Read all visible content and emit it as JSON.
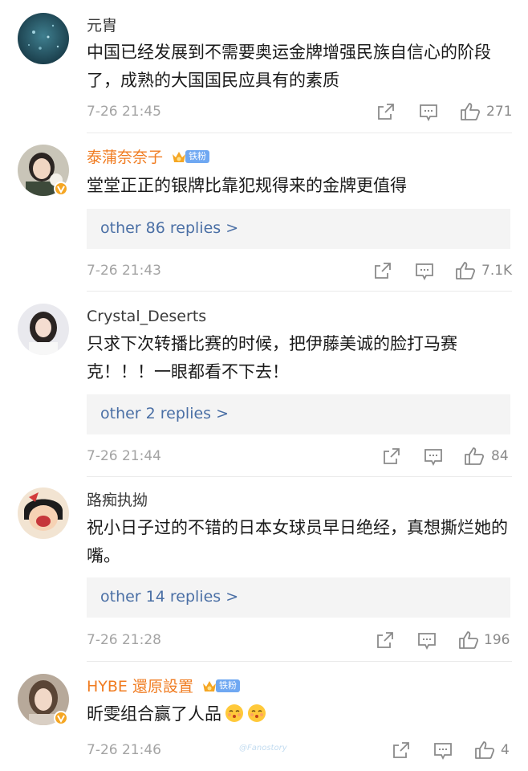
{
  "colors": {
    "accent_name": "#f07c21",
    "reply_link": "#4a6fa5",
    "meta": "#a3a3a3",
    "verified": "#f5a623",
    "fan_tag": "#6fa8f2"
  },
  "icons": [
    "share-icon",
    "comment-icon",
    "like-icon",
    "verified-icon",
    "crown-icon",
    "emoji-icon"
  ],
  "comments": [
    {
      "user": "元胄",
      "text": "中国已经发展到不需要奥运金牌增强民族自信心的阶段了，成熟的大国国民应具有的素质",
      "time": "7-26 21:45",
      "likes": "271"
    },
    {
      "user": "泰蒲奈奈子",
      "fan_tag": "铁粉",
      "text": "堂堂正正的银牌比靠犯规得来的金牌更值得",
      "replies": "other 86 replies >",
      "time": "7-26 21:43",
      "likes": "7.1K"
    },
    {
      "user": "Crystal_Deserts",
      "text": "只求下次转播比赛的时候，把伊藤美诚的脸打马赛克！！！一眼都看不下去！",
      "replies": "other 2 replies >",
      "time": "7-26 21:44",
      "likes": "84"
    },
    {
      "user": "路痴执拗",
      "text": "祝小日子过的不错的日本女球员早日绝经，真想撕烂她的嘴。",
      "replies": "other 14 replies >",
      "time": "7-26 21:28",
      "likes": "196"
    },
    {
      "user": "HYBE 還原設置",
      "fan_tag": "铁粉",
      "text": "昕雯组合赢了人品",
      "time": "7-26 21:46",
      "likes": "4"
    }
  ],
  "watermark": "@Fanostory"
}
